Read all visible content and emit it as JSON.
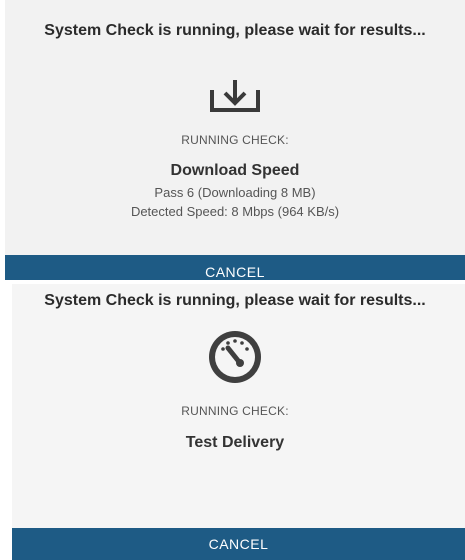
{
  "top_panel": {
    "heading": "System Check is running, please wait for results...",
    "icon": "download-tray-icon",
    "running_label": "RUNNING CHECK:",
    "check_name": "Download Speed",
    "detail_line_1": "Pass 6 (Downloading 8 MB)",
    "detail_line_2": "Detected Speed: 8 Mbps (964 KB/s)",
    "cancel_label": "CANCEL"
  },
  "bottom_panel": {
    "heading": "System Check is running, please wait for results...",
    "icon": "speedometer-gauge-icon",
    "running_label": "RUNNING CHECK:",
    "check_name": "Test Delivery",
    "cancel_label": "CANCEL"
  },
  "colors": {
    "button_background": "#1e5b85",
    "button_text": "#ffffff",
    "panel_background": "#f2f2f2"
  }
}
